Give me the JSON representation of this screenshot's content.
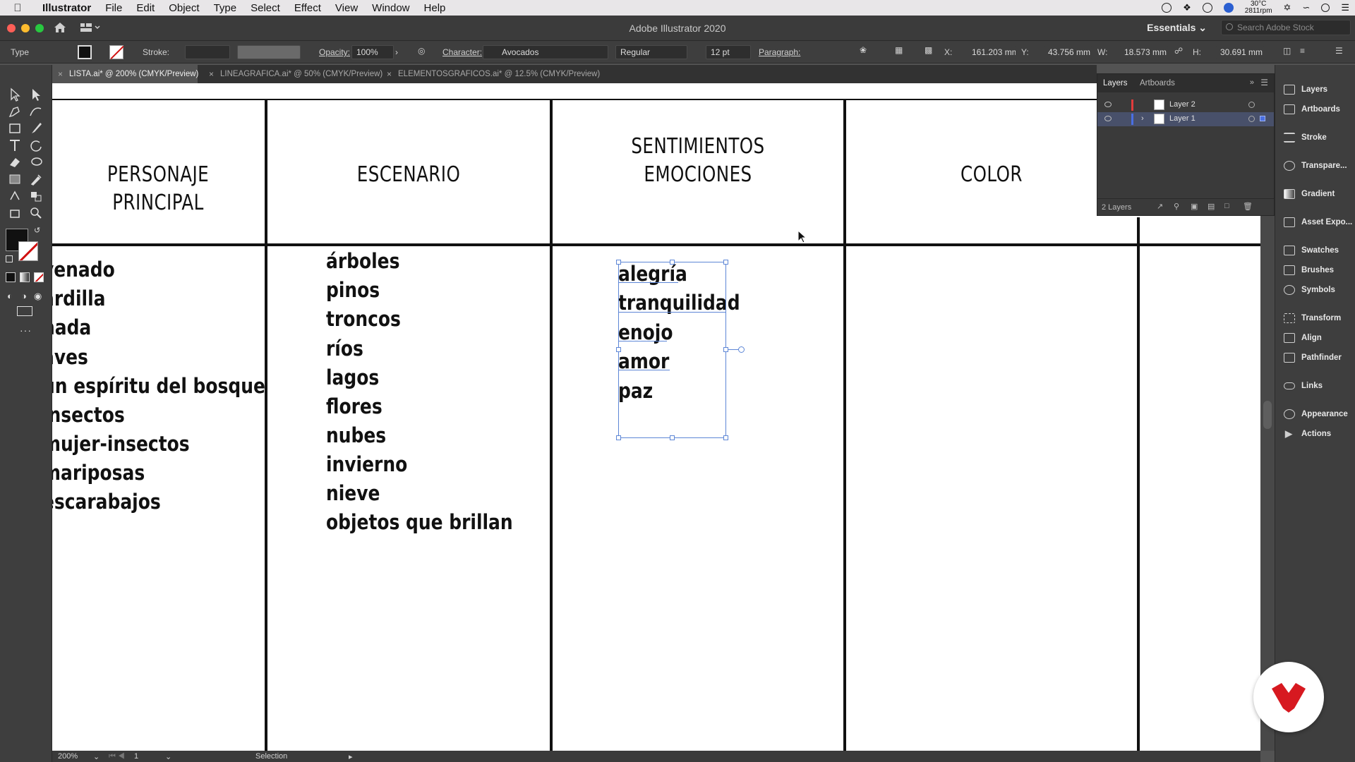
{
  "menubar": {
    "app_name": "Illustrator",
    "items": [
      "File",
      "Edit",
      "Object",
      "Type",
      "Select",
      "Effect",
      "View",
      "Window",
      "Help"
    ],
    "temp_line1": "30°C",
    "temp_line2": "2811rpm"
  },
  "titlebar": {
    "title": "Adobe Illustrator 2020",
    "workspace": "Essentials",
    "stock_search_placeholder": "Search Adobe Stock"
  },
  "controlbar": {
    "tool_name": "Type",
    "stroke_label": "Stroke:",
    "opacity_label": "Opacity:",
    "opacity_value": "100%",
    "character_label": "Character:",
    "font_family": "Avocados",
    "font_style": "Regular",
    "font_size": "12 pt",
    "paragraph_label": "Paragraph:",
    "x_label": "X:",
    "x_value": "161.203 mm",
    "y_label": "Y:",
    "y_value": "43.756 mm",
    "w_label": "W:",
    "w_value": "18.573 mm",
    "h_label": "H:",
    "h_value": "30.691 mm"
  },
  "tabs": [
    {
      "label": "LISTA.ai* @ 200% (CMYK/Preview)",
      "active": true
    },
    {
      "label": "LINEAGRAFICA.ai* @ 50% (CMYK/Preview)",
      "active": false
    },
    {
      "label": "ELEMENTOSGRAFICOS.ai* @ 12.5% (CMYK/Preview)",
      "active": false
    }
  ],
  "canvas": {
    "headers": {
      "col1_line1": "PERSONAJE",
      "col1_line2": "PRINCIPAL",
      "col2": "ESCENARIO",
      "col3_line1": "SENTIMIENTOS",
      "col3_line2": "EMOCIONES",
      "col4": "COLOR"
    },
    "col1_items": [
      "venado",
      "ardilla",
      "hada",
      "aves",
      "un espíritu del bosque",
      "insectos",
      "mujer-insectos",
      "mariposas",
      "escarabajos"
    ],
    "col2_items": [
      "árboles",
      "pinos",
      "troncos",
      "ríos",
      "lagos",
      "flores",
      "nubes",
      "invierno",
      "nieve",
      "objetos que brillan"
    ],
    "col3_items": [
      "alegría",
      "tranquilidad",
      "enojo",
      "amor",
      "paz"
    ]
  },
  "layers_panel": {
    "tab_layers": "Layers",
    "tab_artboards": "Artboards",
    "layers": [
      {
        "name": "Layer 2",
        "color": "#e03c3c",
        "selected": false
      },
      {
        "name": "Layer 1",
        "color": "#4a6fe3",
        "selected": true
      }
    ],
    "count_text": "2 Layers"
  },
  "dock": {
    "items": [
      "Layers",
      "Artboards",
      "Stroke",
      "Transpare...",
      "Gradient",
      "Asset Expo...",
      "Swatches",
      "Brushes",
      "Symbols",
      "Transform",
      "Align",
      "Pathfinder",
      "Links",
      "Appearance",
      "Actions"
    ]
  },
  "statusbar": {
    "zoom": "200%",
    "artboard_num": "1",
    "status_text": "Selection"
  },
  "colors": {
    "selection_blue": "#5d86d6",
    "logo_red": "#d71920"
  }
}
